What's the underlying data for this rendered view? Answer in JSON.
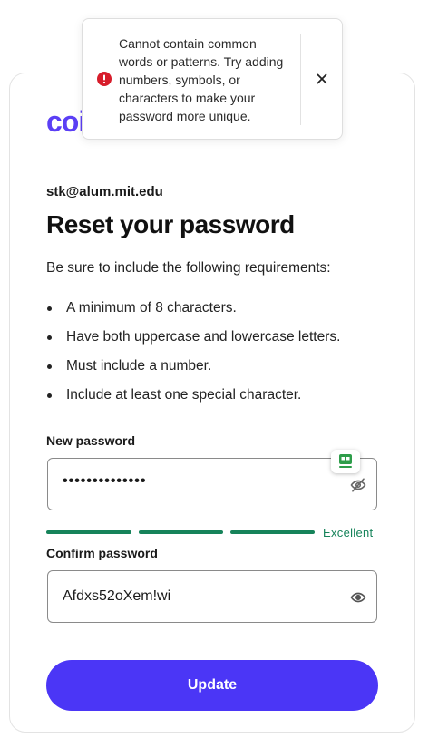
{
  "brand": {
    "logo_text": "coi",
    "accent": "#5b3ff5"
  },
  "account": {
    "email": "stk@alum.mit.edu"
  },
  "page": {
    "title": "Reset your password",
    "intro": "Be sure to include the following requirements:"
  },
  "requirements": [
    "A minimum of 8 characters.",
    "Have both uppercase and lowercase letters.",
    "Must include a number.",
    "Include at least one special character."
  ],
  "new_password": {
    "label": "New password",
    "masked_value": "••••••••••••••",
    "visibility": "hidden",
    "icon": "eye-off-icon"
  },
  "strength": {
    "text": "Excellent",
    "segments_filled": 3,
    "segments_total": 3,
    "color": "#16835a"
  },
  "confirm_password": {
    "label": "Confirm password",
    "value": "Afdxs52oXem!wi",
    "visibility": "visible",
    "icon": "eye-icon"
  },
  "update_button": {
    "label": "Update",
    "color": "#4b36f6"
  },
  "toast": {
    "message": "Cannot contain common words or patterns. Try adding numbers, symbols, or characters to make your password more unique.",
    "icon": "error-icon",
    "icon_color": "#d71d2b",
    "close_icon": "close-icon"
  },
  "password_manager_badge": {
    "icon": "password-manager-icon",
    "color": "#2e9d4a"
  }
}
